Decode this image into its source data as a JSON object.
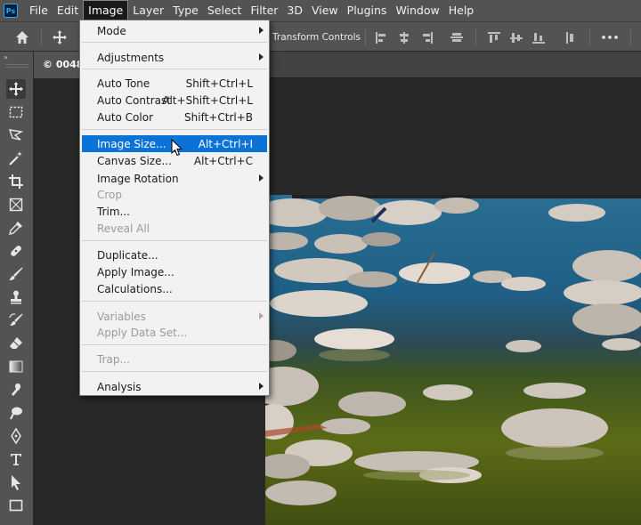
{
  "app": {
    "logo_text": "Ps"
  },
  "menubar": {
    "items": [
      "File",
      "Edit",
      "Image",
      "Layer",
      "Type",
      "Select",
      "Filter",
      "3D",
      "View",
      "Plugins",
      "Window",
      "Help"
    ],
    "active": "Image"
  },
  "optionsbar": {
    "transform_label": "Transform Controls",
    "more_label": "•••"
  },
  "document": {
    "tab_label": "© 0048."
  },
  "toolbar": {
    "collapse_label": "»"
  },
  "image_menu": {
    "mode": "Mode",
    "adjustments": "Adjustments",
    "auto_tone": {
      "label": "Auto Tone",
      "shortcut": "Shift+Ctrl+L"
    },
    "auto_contrast": {
      "label": "Auto Contrast",
      "shortcut": "Alt+Shift+Ctrl+L"
    },
    "auto_color": {
      "label": "Auto Color",
      "shortcut": "Shift+Ctrl+B"
    },
    "image_size": {
      "label": "Image Size...",
      "shortcut": "Alt+Ctrl+I"
    },
    "canvas_size": {
      "label": "Canvas Size...",
      "shortcut": "Alt+Ctrl+C"
    },
    "image_rotation": "Image Rotation",
    "crop": "Crop",
    "trim": "Trim...",
    "reveal_all": "Reveal All",
    "duplicate": "Duplicate...",
    "apply_image": "Apply Image...",
    "calculations": "Calculations...",
    "variables": "Variables",
    "apply_data_set": "Apply Data Set...",
    "trap": "Trap...",
    "analysis": "Analysis"
  },
  "colors": {
    "menu_highlight": "#0b73d8",
    "ui_dark": "#535353",
    "canvas": "#282828"
  }
}
